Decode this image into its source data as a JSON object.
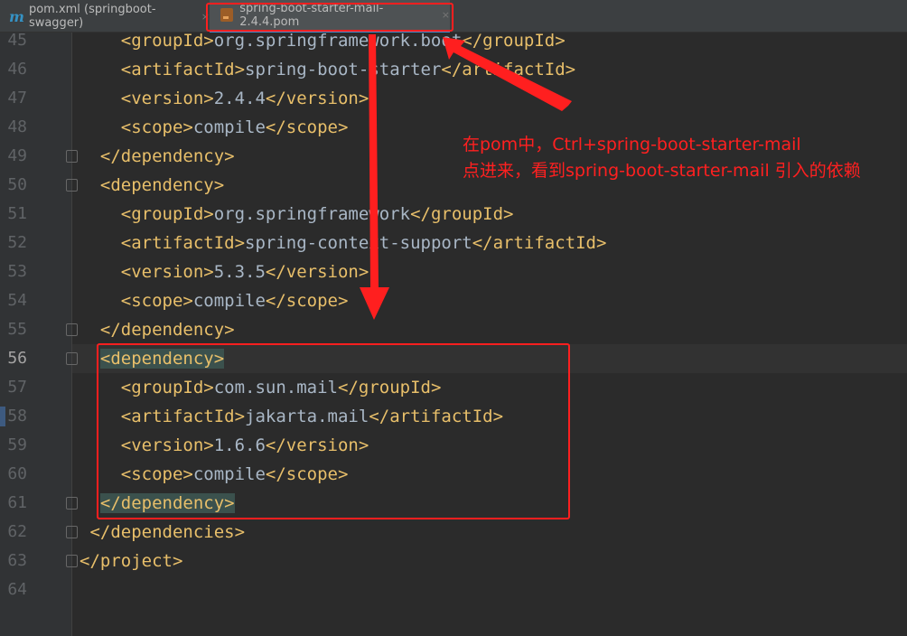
{
  "tabs": [
    {
      "label": "pom.xml (springboot-swagger)",
      "icon": "maven-icon"
    },
    {
      "label": "spring-boot-starter-mail-2.4.4.pom",
      "icon": "xml-file-icon"
    }
  ],
  "tab_close": "×",
  "current_line": "56",
  "lines": [
    {
      "num": "45",
      "parts": [
        {
          "t": "    ",
          "c": "txt"
        },
        {
          "t": "<groupId>",
          "c": "tag"
        },
        {
          "t": "org.springframework.boot",
          "c": "txt"
        },
        {
          "t": "</groupId>",
          "c": "tag"
        }
      ]
    },
    {
      "num": "46",
      "parts": [
        {
          "t": "    ",
          "c": "txt"
        },
        {
          "t": "<artifactId>",
          "c": "tag"
        },
        {
          "t": "spring-boot-starter",
          "c": "txt"
        },
        {
          "t": "</artifactId>",
          "c": "tag"
        }
      ]
    },
    {
      "num": "47",
      "parts": [
        {
          "t": "    ",
          "c": "txt"
        },
        {
          "t": "<version>",
          "c": "tag"
        },
        {
          "t": "2.4.4",
          "c": "txt"
        },
        {
          "t": "</version>",
          "c": "tag"
        }
      ]
    },
    {
      "num": "48",
      "parts": [
        {
          "t": "    ",
          "c": "txt"
        },
        {
          "t": "<scope>",
          "c": "tag"
        },
        {
          "t": "compile",
          "c": "txt"
        },
        {
          "t": "</scope>",
          "c": "tag"
        }
      ]
    },
    {
      "num": "49",
      "fold": true,
      "parts": [
        {
          "t": "  ",
          "c": "txt"
        },
        {
          "t": "</dependency>",
          "c": "tag"
        }
      ]
    },
    {
      "num": "50",
      "fold": true,
      "parts": [
        {
          "t": "  ",
          "c": "txt"
        },
        {
          "t": "<dependency>",
          "c": "tag"
        }
      ]
    },
    {
      "num": "51",
      "parts": [
        {
          "t": "    ",
          "c": "txt"
        },
        {
          "t": "<groupId>",
          "c": "tag"
        },
        {
          "t": "org.springframework",
          "c": "txt"
        },
        {
          "t": "</groupId>",
          "c": "tag"
        }
      ]
    },
    {
      "num": "52",
      "parts": [
        {
          "t": "    ",
          "c": "txt"
        },
        {
          "t": "<artifactId>",
          "c": "tag"
        },
        {
          "t": "spring-context-support",
          "c": "txt"
        },
        {
          "t": "</artifactId>",
          "c": "tag"
        }
      ]
    },
    {
      "num": "53",
      "parts": [
        {
          "t": "    ",
          "c": "txt"
        },
        {
          "t": "<version>",
          "c": "tag"
        },
        {
          "t": "5.3.5",
          "c": "txt"
        },
        {
          "t": "</version>",
          "c": "tag"
        }
      ]
    },
    {
      "num": "54",
      "parts": [
        {
          "t": "    ",
          "c": "txt"
        },
        {
          "t": "<scope>",
          "c": "tag"
        },
        {
          "t": "compile",
          "c": "txt"
        },
        {
          "t": "</scope>",
          "c": "tag"
        }
      ]
    },
    {
      "num": "55",
      "fold": true,
      "parts": [
        {
          "t": "  ",
          "c": "txt"
        },
        {
          "t": "</dependency>",
          "c": "tag"
        }
      ]
    },
    {
      "num": "56",
      "fold": true,
      "parts": [
        {
          "t": "  ",
          "c": "txt"
        },
        {
          "t": "<dependency>",
          "c": "tag match"
        }
      ]
    },
    {
      "num": "57",
      "parts": [
        {
          "t": "    ",
          "c": "txt"
        },
        {
          "t": "<groupId>",
          "c": "tag"
        },
        {
          "t": "com.sun.mail",
          "c": "txt"
        },
        {
          "t": "</groupId>",
          "c": "tag"
        }
      ]
    },
    {
      "num": "58",
      "parts": [
        {
          "t": "    ",
          "c": "txt"
        },
        {
          "t": "<artifactId>",
          "c": "tag"
        },
        {
          "t": "jakarta.mail",
          "c": "txt"
        },
        {
          "t": "</artifactId>",
          "c": "tag"
        }
      ]
    },
    {
      "num": "59",
      "parts": [
        {
          "t": "    ",
          "c": "txt"
        },
        {
          "t": "<version>",
          "c": "tag"
        },
        {
          "t": "1.6.6",
          "c": "txt"
        },
        {
          "t": "</version>",
          "c": "tag"
        }
      ]
    },
    {
      "num": "60",
      "parts": [
        {
          "t": "    ",
          "c": "txt"
        },
        {
          "t": "<scope>",
          "c": "tag"
        },
        {
          "t": "compile",
          "c": "txt"
        },
        {
          "t": "</scope>",
          "c": "tag"
        }
      ]
    },
    {
      "num": "61",
      "fold": true,
      "parts": [
        {
          "t": "  ",
          "c": "txt"
        },
        {
          "t": "</dependency>",
          "c": "tag match"
        }
      ]
    },
    {
      "num": "62",
      "fold": true,
      "parts": [
        {
          "t": " ",
          "c": "txt"
        },
        {
          "t": "</dependencies>",
          "c": "tag"
        }
      ]
    },
    {
      "num": "63",
      "fold": true,
      "parts": [
        {
          "t": "</project>",
          "c": "tag"
        }
      ]
    },
    {
      "num": "64",
      "parts": []
    }
  ],
  "annotation": {
    "line1": "在pom中，Ctrl+spring-boot-starter-mail",
    "line2": "点进来，看到spring-boot-starter-mail 引入的依赖"
  },
  "colors": {
    "annotation": "#ff2020",
    "tag": "#e8bf6a",
    "text": "#a9b7c6",
    "background": "#2b2b2b"
  }
}
